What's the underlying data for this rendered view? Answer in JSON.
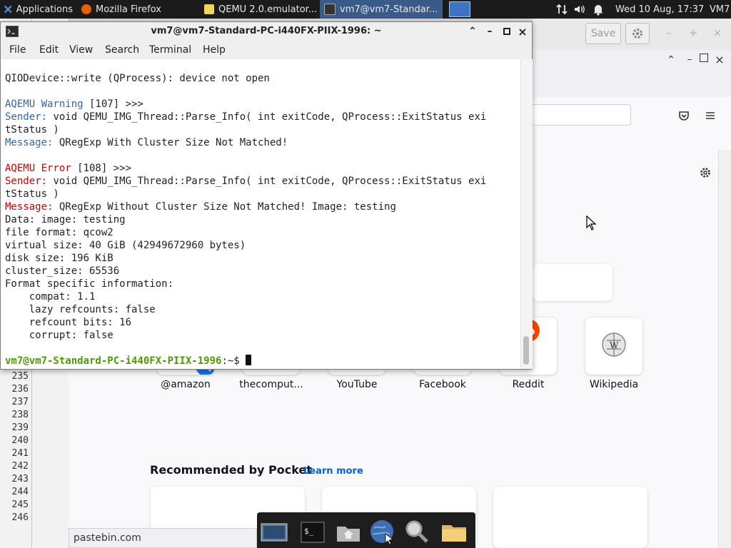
{
  "panel": {
    "applications": "Applications",
    "tasks": [
      {
        "label": "Mozilla Firefox",
        "icon": "firefox-icon"
      },
      {
        "label": "QEMU 2.0.emulator...",
        "icon": "text-editor-icon"
      },
      {
        "label": "vm7@vm7-Standar...",
        "icon": "terminal-icon"
      }
    ],
    "clock": "Wed 10 Aug, 17:37",
    "user": "VM7"
  },
  "editor": {
    "line_numbers": [
      "235",
      "236",
      "237",
      "238",
      "239",
      "240",
      "241",
      "242",
      "243",
      "244",
      "245",
      "246"
    ],
    "save_label": "Save"
  },
  "firefox": {
    "shortcuts": [
      {
        "label": "@amazon",
        "icon": "amazon-icon"
      },
      {
        "label": "thecomput...",
        "icon": "site-icon"
      },
      {
        "label": "YouTube",
        "icon": "youtube-icon"
      },
      {
        "label": "Facebook",
        "icon": "facebook-icon"
      },
      {
        "label": "Reddit",
        "icon": "reddit-icon"
      },
      {
        "label": "Wikipedia",
        "icon": "wikipedia-icon"
      }
    ],
    "pocket_title": "Recommended by Pocket",
    "learn_more": "Learn more",
    "status_url": "pastebin.com"
  },
  "terminal": {
    "title": "vm7@vm7-Standard-PC-i440FX-PIIX-1996: ~",
    "menu": [
      "File",
      "Edit",
      "View",
      "Search",
      "Terminal",
      "Help"
    ],
    "lines": [
      {
        "segments": [
          {
            "text": "QIODevice::write (QProcess): device not open",
            "color": "normal"
          }
        ]
      },
      {
        "segments": []
      },
      {
        "segments": [
          {
            "text": "AQEMU Warning",
            "color": "blue"
          },
          {
            "text": " [107] >>>",
            "color": "normal"
          }
        ]
      },
      {
        "segments": [
          {
            "text": "Sender:",
            "color": "blue"
          },
          {
            "text": " void QEMU_IMG_Thread::Parse_Info( int exitCode, QProcess::ExitStatus exi",
            "color": "normal"
          }
        ]
      },
      {
        "segments": [
          {
            "text": "tStatus )",
            "color": "normal"
          }
        ]
      },
      {
        "segments": [
          {
            "text": "Message:",
            "color": "blue"
          },
          {
            "text": " QRegExp With Cluster Size Not Matched!",
            "color": "normal"
          }
        ]
      },
      {
        "segments": []
      },
      {
        "segments": [
          {
            "text": "AQEMU Error",
            "color": "red"
          },
          {
            "text": " [108] >>>",
            "color": "normal"
          }
        ]
      },
      {
        "segments": [
          {
            "text": "Sender:",
            "color": "red"
          },
          {
            "text": " void QEMU_IMG_Thread::Parse_Info( int exitCode, QProcess::ExitStatus exi",
            "color": "normal"
          }
        ]
      },
      {
        "segments": [
          {
            "text": "tStatus )",
            "color": "normal"
          }
        ]
      },
      {
        "segments": [
          {
            "text": "Message:",
            "color": "red"
          },
          {
            "text": " QRegExp Without Cluster Size Not Matched! Image: testing",
            "color": "normal"
          }
        ]
      },
      {
        "segments": [
          {
            "text": "Data: image: testing",
            "color": "normal"
          }
        ]
      },
      {
        "segments": [
          {
            "text": "file format: qcow2",
            "color": "normal"
          }
        ]
      },
      {
        "segments": [
          {
            "text": "virtual size: 40 GiB (42949672960 bytes)",
            "color": "normal"
          }
        ]
      },
      {
        "segments": [
          {
            "text": "disk size: 196 KiB",
            "color": "normal"
          }
        ]
      },
      {
        "segments": [
          {
            "text": "cluster_size: 65536",
            "color": "normal"
          }
        ]
      },
      {
        "segments": [
          {
            "text": "Format specific information:",
            "color": "normal"
          }
        ]
      },
      {
        "segments": [
          {
            "text": "    compat: 1.1",
            "color": "normal"
          }
        ]
      },
      {
        "segments": [
          {
            "text": "    lazy refcounts: false",
            "color": "normal"
          }
        ]
      },
      {
        "segments": [
          {
            "text": "    refcount bits: 16",
            "color": "normal"
          }
        ]
      },
      {
        "segments": [
          {
            "text": "    corrupt: false",
            "color": "normal"
          }
        ]
      },
      {
        "segments": []
      },
      {
        "segments": [
          {
            "text": "vm7@vm7-Standard-PC-i440FX-PIIX-1996",
            "color": "green"
          },
          {
            "text": ":~$ ",
            "color": "normal"
          }
        ]
      }
    ]
  },
  "dock": {
    "items": [
      "show-desktop-icon",
      "terminal-icon",
      "home-folder-icon",
      "web-browser-icon",
      "search-icon",
      "folder-icon"
    ]
  },
  "colors": {
    "panel_bg": "#1b1b1b",
    "term_blue": "#3465a4",
    "term_red": "#cc0000",
    "term_green": "#4e9a06",
    "pocket_link": "#0061e0"
  }
}
